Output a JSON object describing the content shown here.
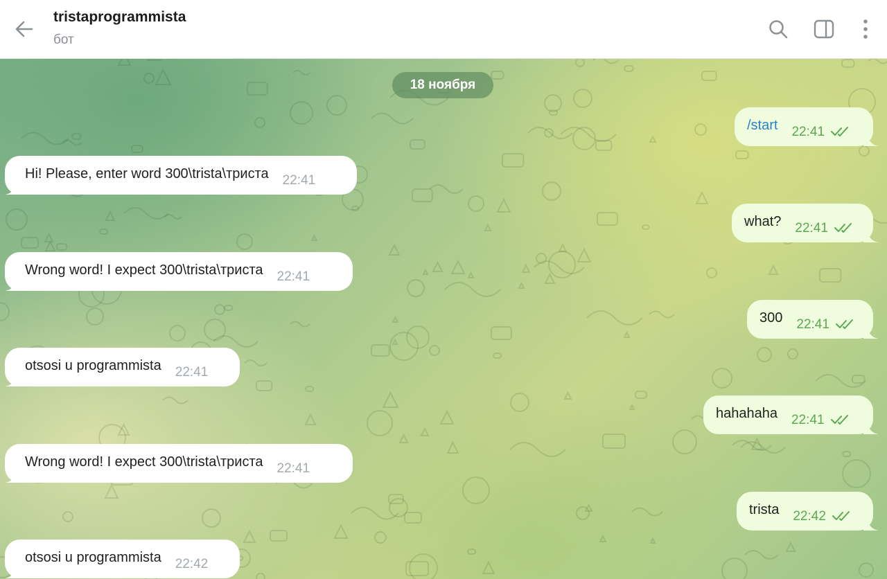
{
  "header": {
    "title": "tristaprogrammista",
    "subtitle": "бот",
    "icons": [
      "back-arrow-icon",
      "search-icon",
      "sidebar-toggle-icon",
      "more-vertical-icon"
    ]
  },
  "chat": {
    "date_label": "18 ноября",
    "messages": [
      {
        "direction": "out",
        "text": "/start",
        "time": "22:41",
        "status": "read"
      },
      {
        "direction": "in",
        "text": "Hi! Please, enter word 300\\trista\\триста",
        "time": "22:41"
      },
      {
        "direction": "out",
        "text": "what?",
        "time": "22:41",
        "status": "read"
      },
      {
        "direction": "in",
        "text": "Wrong word! I expect 300\\trista\\триста",
        "time": "22:41"
      },
      {
        "direction": "out",
        "text": "300",
        "time": "22:41",
        "status": "read"
      },
      {
        "direction": "in",
        "text": "otsosi u programmista",
        "time": "22:41"
      },
      {
        "direction": "out",
        "text": "hahahaha",
        "time": "22:41",
        "status": "read"
      },
      {
        "direction": "in",
        "text": "Wrong word! I expect 300\\trista\\триста",
        "time": "22:41"
      },
      {
        "direction": "out",
        "text": "trista",
        "time": "22:42",
        "status": "read"
      },
      {
        "direction": "in",
        "text": "otsosi u programmista",
        "time": "22:42"
      }
    ]
  },
  "colors": {
    "incoming_bubble": "#ffffff",
    "outgoing_bubble": "#effdde",
    "read_check": "#5aa850",
    "command_link": "#2a82c6"
  }
}
